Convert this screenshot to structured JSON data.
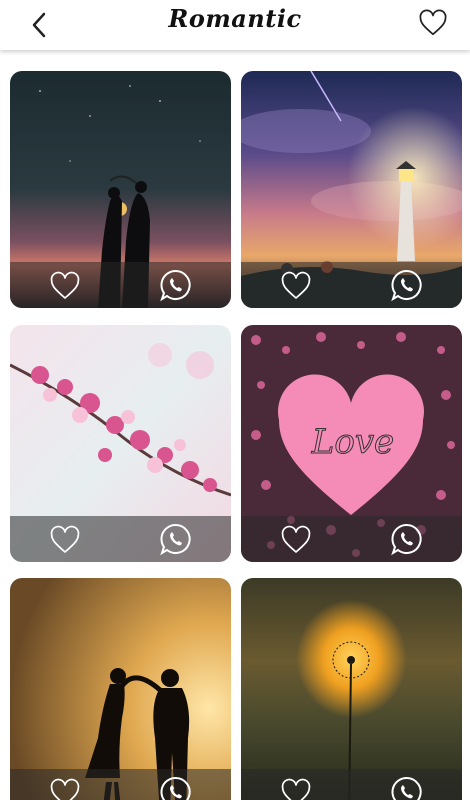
{
  "header": {
    "title": "Romantic",
    "back_icon": "chevron-left-icon",
    "favorite_icon": "heart-outline-icon"
  },
  "wallpapers": [
    {
      "subject": "couple-under-stars",
      "icons": [
        "heart-outline-icon",
        "whatsapp-icon"
      ]
    },
    {
      "subject": "lighthouse-night-sky",
      "icons": [
        "heart-outline-icon",
        "whatsapp-icon"
      ]
    },
    {
      "subject": "cherry-blossoms",
      "icons": [
        "heart-outline-icon",
        "whatsapp-icon"
      ]
    },
    {
      "subject": "pink-love-heart",
      "text": "Love",
      "icons": [
        "heart-outline-icon",
        "whatsapp-icon"
      ]
    },
    {
      "subject": "dancing-couple-sunset",
      "icons": [
        "heart-outline-icon",
        "whatsapp-icon"
      ]
    },
    {
      "subject": "dandelion-sunset",
      "icons": [
        "heart-outline-icon",
        "whatsapp-icon"
      ]
    }
  ],
  "colors": {
    "header_bg": "#ffffff",
    "action_bar_bg": "rgba(40,40,40,0.55)",
    "icon_color": "#ffffff"
  }
}
